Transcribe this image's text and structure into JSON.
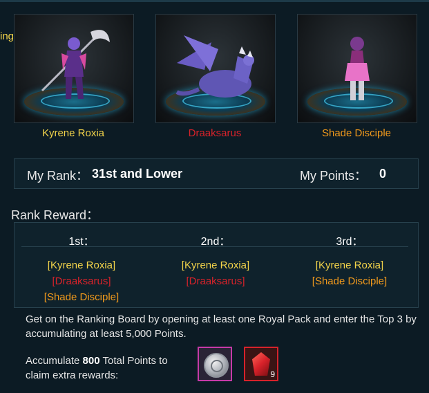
{
  "header": {
    "cut_label": "ing"
  },
  "characters": [
    {
      "name": "Kyrene Roxia",
      "color": "#f2d34a",
      "icon": "warrior-figure-icon"
    },
    {
      "name": "Draaksarus",
      "color": "#d8222a",
      "icon": "dragon-icon"
    },
    {
      "name": "Shade Disciple",
      "color": "#f29a1c",
      "icon": "disciple-figure-icon"
    }
  ],
  "rank": {
    "my_rank_label": "My Rank：",
    "my_rank_value": "31st and Lower",
    "my_points_label": "My Points：",
    "my_points_value": "0"
  },
  "rank_reward": {
    "title": "Rank Reward：",
    "columns": [
      {
        "head": "1st：",
        "items": [
          "[Kyrene Roxia]",
          "[Draaksarus]",
          "[Shade Disciple]"
        ]
      },
      {
        "head": "2nd：",
        "items": [
          "[Kyrene Roxia]",
          "[Draaksarus]"
        ]
      },
      {
        "head": "3rd：",
        "items": [
          "[Kyrene Roxia]",
          "[Shade Disciple]"
        ]
      }
    ]
  },
  "info_text": "Get on the Ranking Board by opening at least one Royal Pack and enter the Top 3 by accumulating at least 5,000 Points.",
  "accumulate": {
    "prefix": "Accumulate ",
    "points": "800",
    "suffix": " Total Points to claim extra rewards:"
  },
  "extra_rewards": [
    {
      "icon": "silver-coin-icon",
      "count": ""
    },
    {
      "icon": "red-crystal-icon",
      "count": "9"
    }
  ]
}
